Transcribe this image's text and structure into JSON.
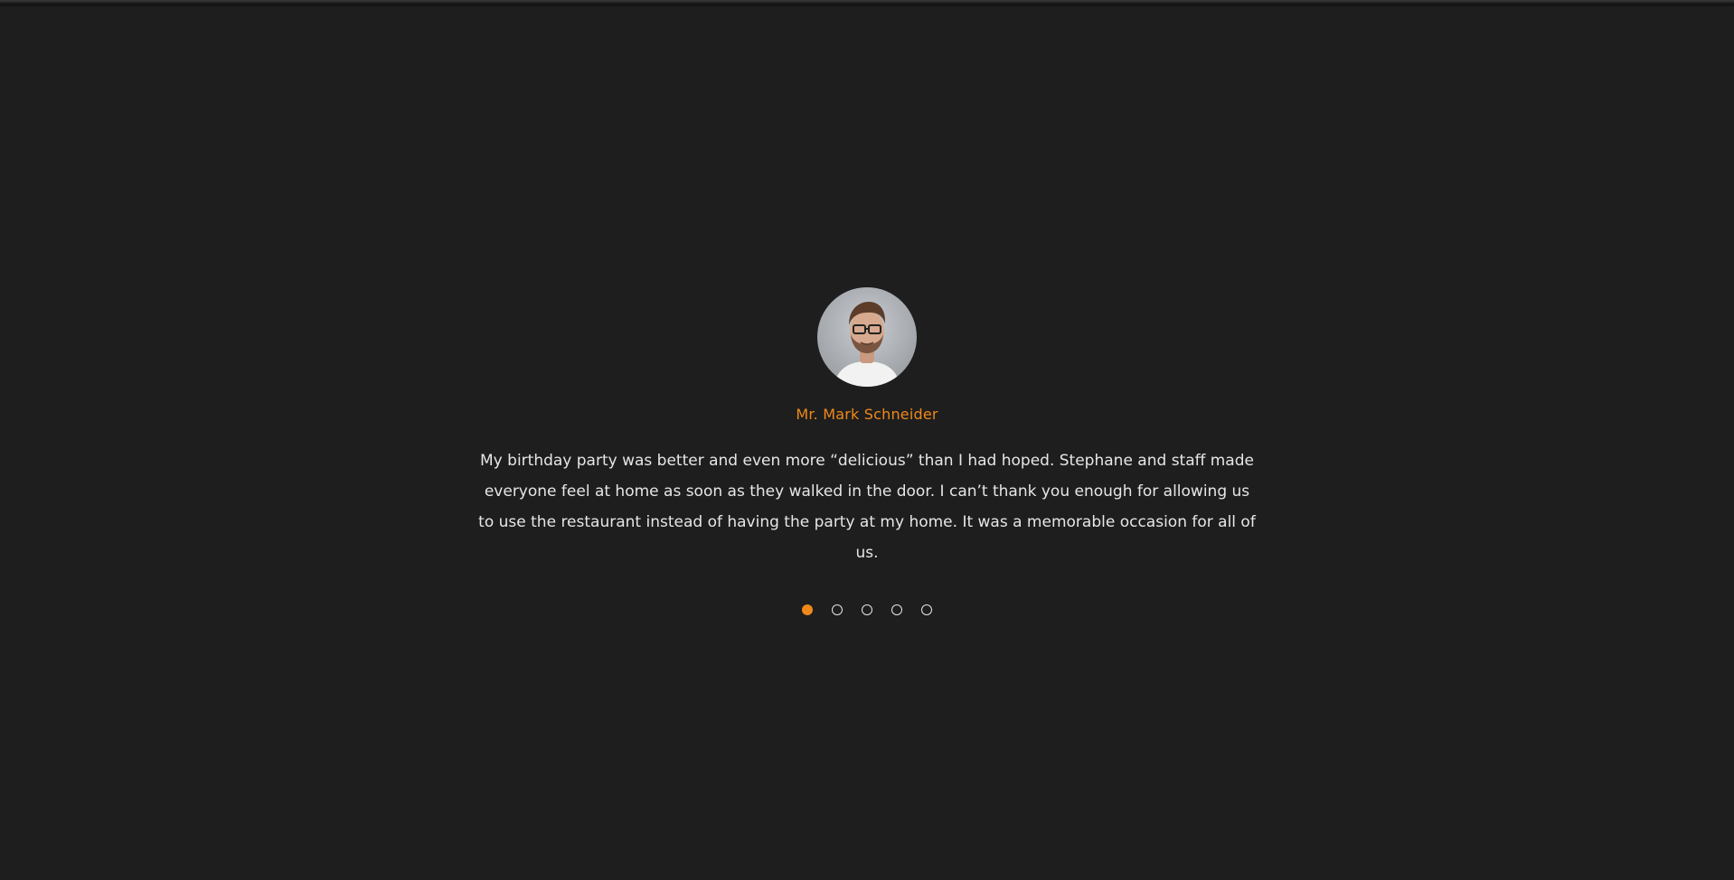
{
  "testimonial": {
    "name": "Mr. Mark Schneider",
    "quote": "My birthday party was better and even more “delicious” than I had hoped. Stephane and staff made everyone feel at home as soon as they walked in the door. I can’t thank you enough for allowing us to use the restaurant instead of having the party at my home. It was a memorable occasion for all of us.",
    "avatar_icon": "user-photo-avatar"
  },
  "carousel": {
    "total": 5,
    "active_index": 0
  },
  "colors": {
    "background": "#1e1e1e",
    "accent": "#f0891a",
    "text": "#e6e6e6"
  }
}
